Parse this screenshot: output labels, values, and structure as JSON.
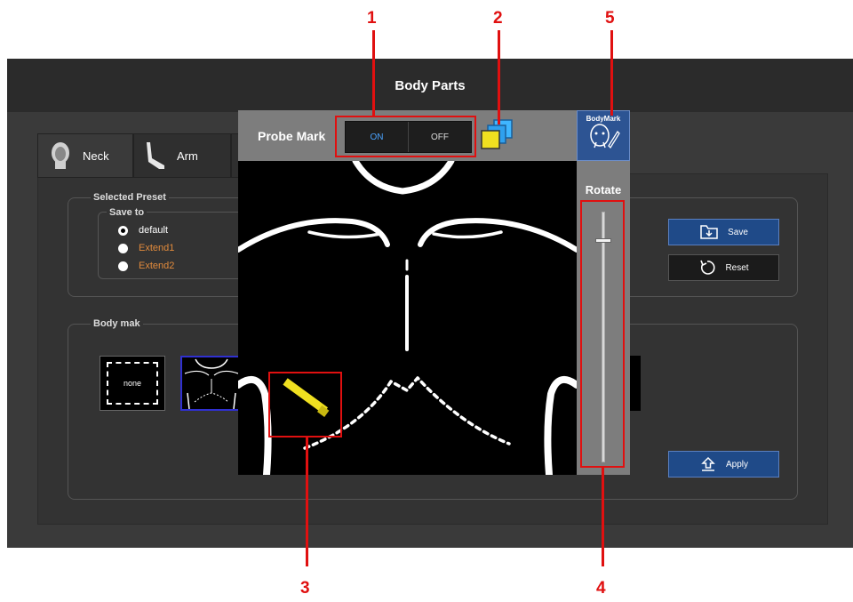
{
  "window": {
    "title": "Body Parts"
  },
  "tabs": [
    {
      "label": "Neck",
      "icon": "head-icon"
    },
    {
      "label": "Arm",
      "icon": "arm-icon"
    }
  ],
  "selected_preset": {
    "group_title": "Selected Preset",
    "save_to_title": "Save to",
    "options": [
      {
        "label": "default",
        "selected": true
      },
      {
        "label": "Extend1",
        "selected": false
      },
      {
        "label": "Extend2",
        "selected": false
      }
    ]
  },
  "actions": {
    "save_label": "Save",
    "reset_label": "Reset",
    "apply_label": "Apply"
  },
  "body_mark": {
    "group_title": "Body mak",
    "none_label": "none"
  },
  "overlay": {
    "probe_mark_label": "Probe Mark",
    "toggle_on": "ON",
    "toggle_off": "OFF",
    "toggle_state": "ON",
    "bodymark_button_label": "BodyMark",
    "rotate_label": "Rotate"
  },
  "callouts": [
    "1",
    "2",
    "3",
    "4",
    "5"
  ],
  "colors": {
    "accent_blue": "#1f4a88",
    "probe_yellow": "#f0e020",
    "annotation_red": "#e01010",
    "extend_orange": "#e08a3c"
  }
}
